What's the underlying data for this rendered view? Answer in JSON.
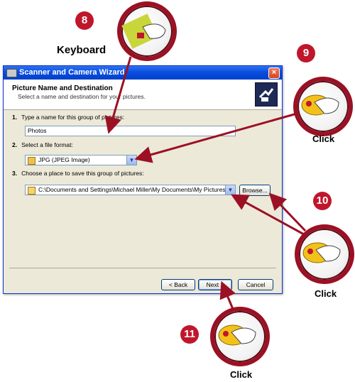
{
  "window": {
    "title": "Scanner and Camera Wizard",
    "header_title": "Picture Name and Destination",
    "header_subtitle": "Select a name and destination for your pictures."
  },
  "steps": [
    {
      "number": "1.",
      "label": "Type a name for this group of pictures:"
    },
    {
      "number": "2.",
      "label": "Select a file format:"
    },
    {
      "number": "3.",
      "label": "Choose a place to save this group of pictures:"
    }
  ],
  "fields": {
    "name_value": "Photos",
    "format_value": "JPG (JPEG Image)",
    "location_value": "C:\\Documents and Settings\\Michael Miller\\My Documents\\My Pictures\\Molehill"
  },
  "buttons": {
    "browse": "Browse...",
    "back": "< Back",
    "next": "Next >",
    "cancel": "Cancel"
  },
  "callouts": [
    {
      "number": "8",
      "label": "Keyboard"
    },
    {
      "number": "9",
      "label": "Click"
    },
    {
      "number": "10",
      "label": "Click"
    },
    {
      "number": "11",
      "label": "Click"
    }
  ],
  "colors": {
    "callout_red": "#9c1024",
    "titlebar_blue": "#0a4ee0"
  }
}
